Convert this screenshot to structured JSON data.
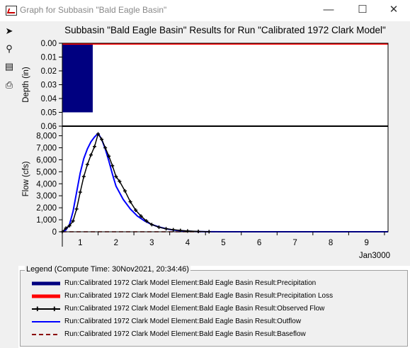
{
  "window": {
    "title": "Graph for Subbasin \"Bald Eagle Basin\"",
    "minimize_symbol": "—",
    "maximize_symbol": "☐",
    "close_symbol": "✕"
  },
  "toolbar": {
    "tools": [
      {
        "name": "select-tool",
        "glyph": "➤"
      },
      {
        "name": "zoom-tool",
        "glyph": "⚲"
      },
      {
        "name": "properties-tool",
        "glyph": "▤"
      },
      {
        "name": "print-tool",
        "glyph": "⎙"
      }
    ]
  },
  "chart_data": {
    "title": "Subbasin \"Bald Eagle Basin\" Results for Run \"Calibrated 1972 Clark Model\"",
    "x_ticks": [
      "1",
      "2",
      "3",
      "4",
      "5",
      "6",
      "7",
      "8",
      "9"
    ],
    "x_period_label": "Jan3000",
    "x_range": [
      0.5,
      9.6
    ],
    "panels": [
      {
        "type": "bar",
        "ylabel": "Depth (in)",
        "y_reversed": true,
        "ylim": [
          0,
          0.06
        ],
        "y_ticks": [
          "0.00",
          "0.01",
          "0.02",
          "0.03",
          "0.04",
          "0.05",
          "0.06"
        ],
        "series": [
          {
            "name": "Run:Calibrated 1972 Clark Model Element:Bald Eagle Basin Result:Precipitation",
            "color": "#000080",
            "x": [
              0.5,
              1.35
            ],
            "values": [
              0.05,
              0.05
            ]
          },
          {
            "name": "Run:Calibrated 1972 Clark Model Element:Bald Eagle Basin Result:Precipitation Loss",
            "color": "#ff0000",
            "x": [
              0.5,
              9.6
            ],
            "values": [
              0,
              0
            ]
          }
        ]
      },
      {
        "type": "line",
        "ylabel": "Flow (cfs)",
        "ylim": [
          0,
          8800
        ],
        "y_ticks": [
          "0",
          "1,000",
          "2,000",
          "3,000",
          "4,000",
          "5,000",
          "6,000",
          "7,000",
          "8,000"
        ],
        "series": [
          {
            "name": "Run:Calibrated 1972 Clark Model Element:Bald Eagle Basin Result:Observed Flow",
            "color": "#000000",
            "x": [
              0.5,
              0.6,
              0.7,
              0.8,
              0.9,
              1.0,
              1.1,
              1.2,
              1.3,
              1.4,
              1.5,
              1.6,
              1.7,
              1.8,
              1.9,
              2.0,
              2.1,
              2.25,
              2.4,
              2.55,
              2.7,
              2.85,
              3.0,
              3.2,
              3.4,
              3.6,
              3.8,
              4.0,
              4.3,
              4.6
            ],
            "values": [
              0,
              300,
              500,
              900,
              1900,
              3300,
              4600,
              5600,
              6400,
              7100,
              8150,
              7700,
              7000,
              6300,
              5500,
              4600,
              4200,
              3400,
              2500,
              1800,
              1300,
              900,
              600,
              380,
              250,
              170,
              110,
              70,
              30,
              10
            ]
          },
          {
            "name": "Run:Calibrated 1972 Clark Model Element:Bald Eagle Basin Result:Outflow",
            "color": "#0000ff",
            "x": [
              0.5,
              0.6,
              0.7,
              0.8,
              0.9,
              1.0,
              1.1,
              1.2,
              1.3,
              1.4,
              1.5,
              1.6,
              1.7,
              1.8,
              1.9,
              2.0,
              2.2,
              2.4,
              2.6,
              2.8,
              3.0,
              3.2,
              3.4,
              3.6,
              3.8,
              4.0,
              4.2,
              4.5,
              5.0,
              9.6
            ],
            "values": [
              0,
              150,
              600,
              1700,
              3300,
              4900,
              6100,
              6900,
              7500,
              7900,
              8200,
              7700,
              6900,
              5900,
              4800,
              3800,
              2700,
              1900,
              1300,
              900,
              600,
              400,
              250,
              150,
              90,
              50,
              25,
              10,
              0,
              0
            ]
          },
          {
            "name": "Run:Calibrated 1972 Clark Model Element:Bald Eagle Basin Result:Baseflow",
            "color": "#8b0000",
            "dashed": true,
            "x": [
              0.5,
              9.6
            ],
            "values": [
              0,
              0
            ]
          }
        ]
      }
    ]
  },
  "legend": {
    "caption": "Legend (Compute Time: 30Nov2021, 20:34:46)",
    "items": [
      {
        "label": "Run:Calibrated 1972 Clark Model Element:Bald Eagle Basin Result:Precipitation",
        "color": "#000080",
        "style": "thick"
      },
      {
        "label": "Run:Calibrated 1972 Clark Model Element:Bald Eagle Basin Result:Precipitation Loss",
        "color": "#ff0000",
        "style": "thick"
      },
      {
        "label": "Run:Calibrated 1972 Clark Model Element:Bald Eagle Basin Result:Observed Flow",
        "color": "#000000",
        "style": "marker"
      },
      {
        "label": "Run:Calibrated 1972 Clark Model Element:Bald Eagle Basin Result:Outflow",
        "color": "#0000ff",
        "style": "solid"
      },
      {
        "label": "Run:Calibrated 1972 Clark Model Element:Bald Eagle Basin Result:Baseflow",
        "color": "#8b0000",
        "style": "dashed"
      }
    ]
  }
}
